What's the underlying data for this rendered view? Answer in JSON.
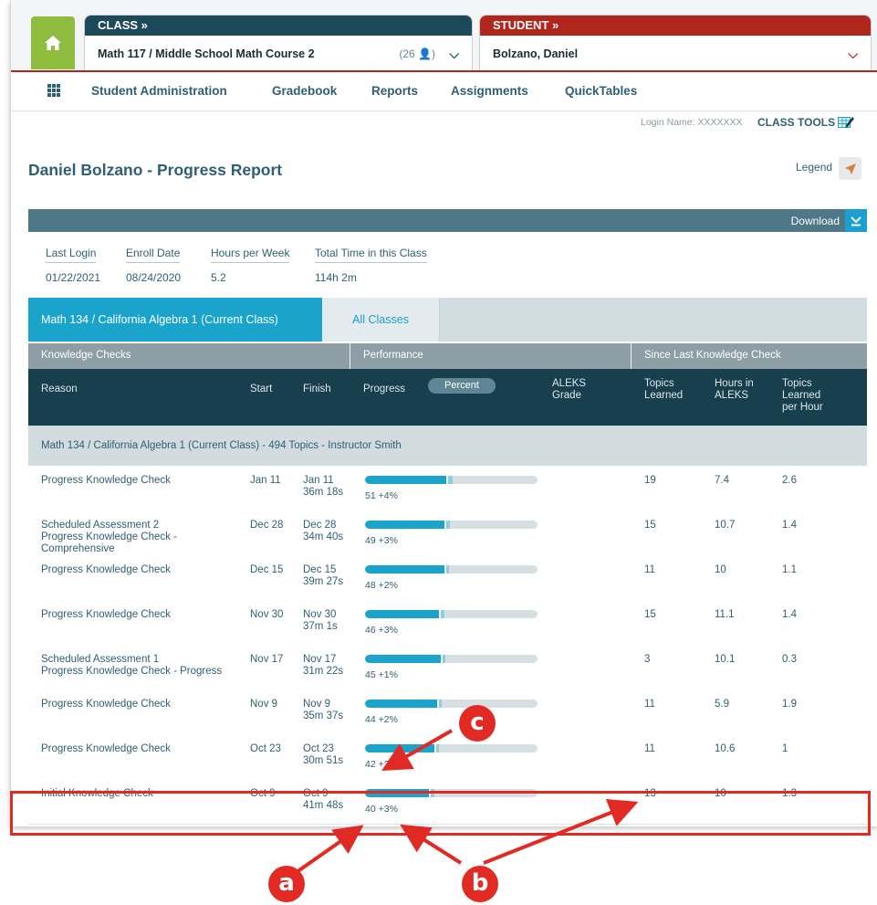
{
  "header": {
    "class_label": "CLASS »",
    "class_name": "Math 117 / Middle School Math Course 2",
    "class_count": "(26 👤)",
    "student_label": "STUDENT »",
    "student_name": "Bolzano, Daniel"
  },
  "nav": {
    "items": [
      "Student Administration",
      "Gradebook",
      "Reports",
      "Assignments",
      "QuickTables"
    ]
  },
  "toolbar": {
    "login_name": "Login Name: XXXXXXX",
    "class_tools": "CLASS TOOLS"
  },
  "page_title": "Daniel Bolzano - Progress Report",
  "legend_label": "Legend",
  "download_label": "Download",
  "meta": {
    "labels": [
      "Last Login",
      "Enroll Date",
      "Hours per Week",
      "Total Time in this Class"
    ],
    "values": [
      "01/22/2021",
      "08/24/2020",
      "5.2",
      "114h 2m"
    ]
  },
  "tabs": {
    "current": "Math 134 / California Algebra 1 (Current Class)",
    "all": "All Classes"
  },
  "group_headers": [
    "Knowledge Checks",
    "Performance",
    "Since Last Knowledge Check"
  ],
  "columns": {
    "reason": "Reason",
    "start": "Start",
    "finish": "Finish",
    "progress": "Progress",
    "percent_toggle": "Percent",
    "aleks_grade": "ALEKS Grade",
    "topics_learned": "Topics Learned",
    "hours_in_aleks": "Hours in ALEKS",
    "topics_per_hour": "Topics Learned per Hour"
  },
  "section_title": "Math 134 / California Algebra 1 (Current Class) - 494 Topics - Instructor Smith",
  "rows": [
    {
      "reason": "Progress Knowledge Check",
      "start": "Jan 11",
      "finish_date": "Jan 11",
      "finish_time": "36m 18s",
      "progress": 51,
      "increase": 4,
      "progress_label": "51 +4%",
      "topics": "19",
      "hours": "7.4",
      "rate": "2.6"
    },
    {
      "reason": "Scheduled Assessment 2\nProgress Knowledge Check -\nComprehensive",
      "start": "Dec 28",
      "finish_date": "Dec 28",
      "finish_time": "34m 40s",
      "progress": 49,
      "increase": 3,
      "progress_label": "49 +3%",
      "topics": "15",
      "hours": "10.7",
      "rate": "1.4"
    },
    {
      "reason": "Progress Knowledge Check",
      "start": "Dec 15",
      "finish_date": "Dec 15",
      "finish_time": "39m 27s",
      "progress": 48,
      "increase": 2,
      "progress_label": "48 +2%",
      "topics": "11",
      "hours": "10",
      "rate": "1.1"
    },
    {
      "reason": "Progress Knowledge Check",
      "start": "Nov 30",
      "finish_date": "Nov 30",
      "finish_time": "37m 1s",
      "progress": 46,
      "increase": 3,
      "progress_label": "46 +3%",
      "topics": "15",
      "hours": "11.1",
      "rate": "1.4"
    },
    {
      "reason": "Scheduled Assessment 1\nProgress Knowledge Check - Progress",
      "start": "Nov 17",
      "finish_date": "Nov 17",
      "finish_time": "31m 22s",
      "progress": 45,
      "increase": 1,
      "progress_label": "45 +1%",
      "topics": "3",
      "hours": "10.1",
      "rate": "0.3"
    },
    {
      "reason": "Progress Knowledge Check",
      "start": "Nov 9",
      "finish_date": "Nov 9",
      "finish_time": "35m 37s",
      "progress": 44,
      "increase": 2,
      "progress_label": "44 +2%",
      "topics": "11",
      "hours": "5.9",
      "rate": "1.9"
    },
    {
      "reason": "Progress Knowledge Check",
      "start": "Oct 23",
      "finish_date": "Oct 23",
      "finish_time": "30m 51s",
      "progress": 42,
      "increase": 2,
      "progress_label": "42 +2%",
      "topics": "11",
      "hours": "10.6",
      "rate": "1"
    },
    {
      "reason": "Initial Knowledge Check",
      "start": "Oct 9",
      "finish_date": "Oct 9",
      "finish_time": "41m 48s",
      "progress": 40,
      "increase": 3,
      "progress_label": "40 +3%",
      "topics": "13",
      "hours": "10",
      "rate": "1.3"
    }
  ],
  "callouts": {
    "a": "a",
    "b": "b",
    "c": "c"
  },
  "colors": {
    "accent": "#1ba4cb",
    "brand_dark": "#183f4e",
    "student_red": "#b0261d",
    "annotation_red": "#e22a24",
    "home_green": "#8ebd3f"
  }
}
